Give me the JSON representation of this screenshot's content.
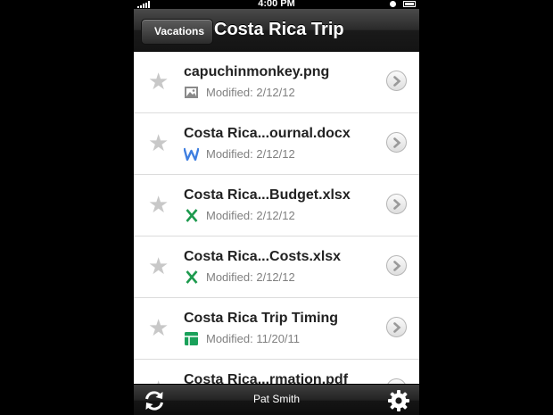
{
  "status_bar": {
    "time": "4:00 PM"
  },
  "nav": {
    "back_label": "Vacations",
    "title": "Costa Rica Trip"
  },
  "files": [
    {
      "name": "capuchinmonkey.png",
      "modified": "Modified: 2/12/12",
      "type_icon": "image-icon"
    },
    {
      "name": "Costa Rica...ournal.docx",
      "modified": "Modified: 2/12/12",
      "type_icon": "word-doc-icon"
    },
    {
      "name": "Costa Rica...Budget.xlsx",
      "modified": "Modified: 2/12/12",
      "type_icon": "excel-icon"
    },
    {
      "name": "Costa Rica...Costs.xlsx",
      "modified": "Modified: 2/12/12",
      "type_icon": "excel-icon"
    },
    {
      "name": "Costa Rica Trip Timing",
      "modified": "Modified: 11/20/11",
      "type_icon": "spreadsheet-icon"
    },
    {
      "name": "Costa Rica...rmation.pdf",
      "modified": "",
      "type_icon": "pdf-icon"
    }
  ],
  "toolbar": {
    "user_name": "Pat Smith"
  },
  "colors": {
    "word_blue": "#3f7fe0",
    "excel_green": "#1d9a4e",
    "sheet_green": "#1aa15a"
  }
}
